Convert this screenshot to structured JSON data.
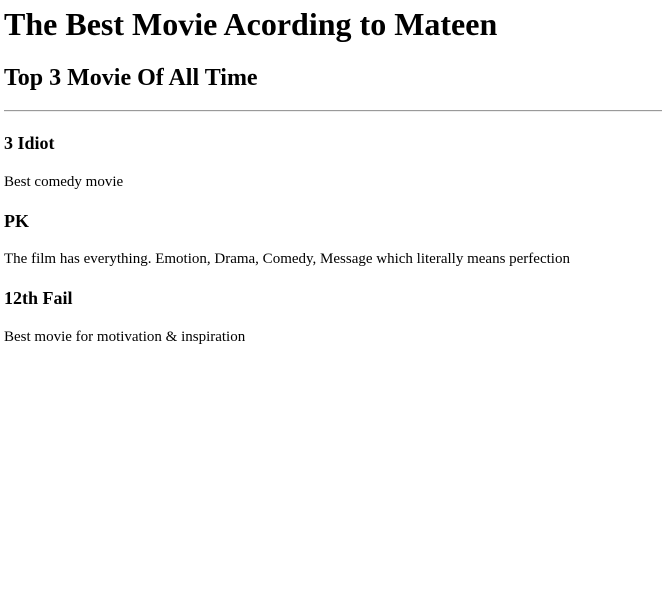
{
  "page": {
    "title": "The Best Movie Acording to Mateen",
    "subtitle": "Top 3 Movie Of All Time"
  },
  "movies": [
    {
      "title": "3 Idiot",
      "description": "Best comedy movie"
    },
    {
      "title": "PK",
      "description": "The film has everything. Emotion, Drama, Comedy, Message which literally means perfection"
    },
    {
      "title": "12th Fail",
      "description": "Best movie for motivation & inspiration"
    }
  ]
}
